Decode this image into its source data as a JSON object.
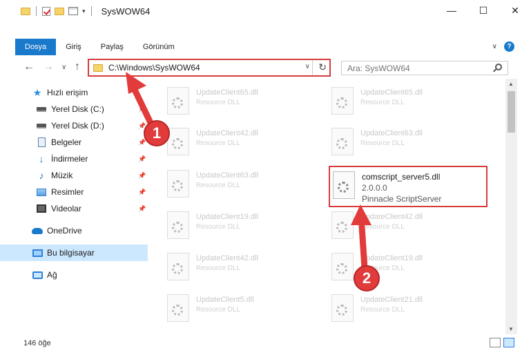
{
  "window": {
    "title": "SysWOW64",
    "minimize": "—",
    "maximize": "☐",
    "close": "✕"
  },
  "ribbon": {
    "tabs": [
      "Dosya",
      "Giriş",
      "Paylaş",
      "Görünüm"
    ],
    "help": "?"
  },
  "nav": {
    "back": "←",
    "forward": "→",
    "recent": "∨",
    "up": "↑"
  },
  "address": {
    "path": "C:\\Windows\\SysWOW64",
    "refresh": "↻"
  },
  "search": {
    "placeholder": "Ara: SysWOW64"
  },
  "sidebar": {
    "items": [
      {
        "label": "Hızlı erişim"
      },
      {
        "label": "Yerel Disk (C:)"
      },
      {
        "label": "Yerel Disk (D:)"
      },
      {
        "label": "Belgeler"
      },
      {
        "label": "İndirmeler"
      },
      {
        "label": "Müzik"
      },
      {
        "label": "Resimler"
      },
      {
        "label": "Videolar"
      },
      {
        "label": "OneDrive"
      },
      {
        "label": "Bu bilgisayar"
      },
      {
        "label": "Ağ"
      }
    ]
  },
  "files": [
    {
      "name": "UpdateClient65.dll",
      "desc": "Resource DLL"
    },
    {
      "name": "UpdateClient65.dll",
      "desc": "Resource DLL"
    },
    {
      "name": "UpdateClient42.dll",
      "desc": "Resource DLL"
    },
    {
      "name": "UpdateClient63.dll",
      "desc": "Resource DLL"
    },
    {
      "name": "UpdateClient63.dll",
      "desc": "Resource DLL"
    },
    {
      "name": "comscript_server5.dll",
      "version": "2.0.0.0",
      "company": "Pinnacle ScriptServer"
    },
    {
      "name": "UpdateClient19.dll",
      "desc": "Resource DLL"
    },
    {
      "name": "UpdateClient42.dll",
      "desc": "Resource DLL"
    },
    {
      "name": "UpdateClient42.dll",
      "desc": "Resource DLL"
    },
    {
      "name": "UpdateClient19.dll",
      "desc": "Resource DLL"
    },
    {
      "name": "UpdateClient5.dll",
      "desc": "Resource DLL"
    },
    {
      "name": "UpdateClient21.dll",
      "desc": "Resource DLL"
    }
  ],
  "status": {
    "count": "146 öğe"
  },
  "annotations": {
    "step1": "1",
    "step2": "2",
    "color": "#e23b3b"
  }
}
